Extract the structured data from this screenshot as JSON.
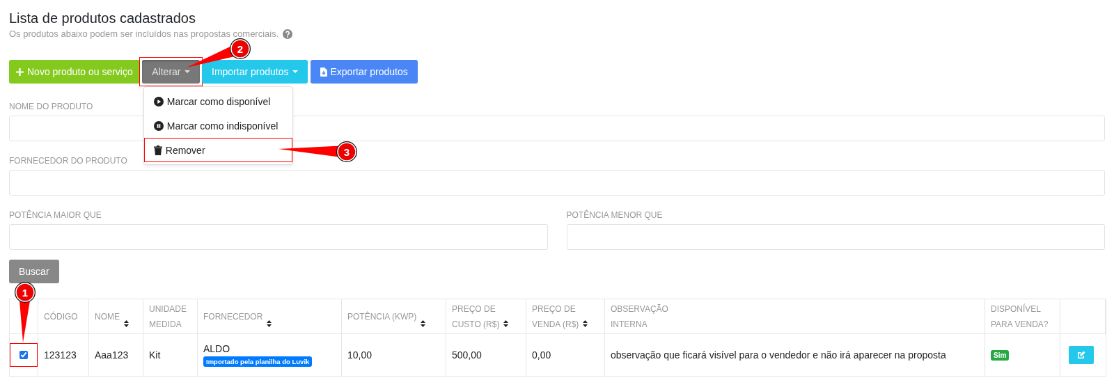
{
  "page": {
    "title": "Lista de produtos cadastrados",
    "subtitle": "Os produtos abaixo podem ser incluídos nas propostas comerciais."
  },
  "toolbar": {
    "buttons": [
      {
        "label": "Novo produto ou serviço",
        "kind": "add"
      },
      {
        "label": "Alterar",
        "kind": "dropdown",
        "expanded": true,
        "highlighted": true
      },
      {
        "label": "Importar produtos",
        "kind": "dropdown",
        "expanded": false
      },
      {
        "label": "Exportar produtos",
        "kind": "export"
      }
    ]
  },
  "dropdown_menu": {
    "items": [
      {
        "label": "Marcar como disponível"
      },
      {
        "label": "Marcar como indisponível"
      },
      {
        "label": "Remover",
        "highlighted": true
      }
    ]
  },
  "filters": [
    [
      {
        "label": "NOME DO PRODUTO"
      }
    ],
    [
      {
        "label": "FORNECEDOR DO PRODUTO"
      }
    ],
    [
      {
        "label": "POTÊNCIA MAIOR QUE"
      },
      {
        "label": "POTÊNCIA MENOR QUE"
      }
    ]
  ],
  "search_button": "Buscar",
  "table": {
    "columns": [
      {
        "label": "CÓDIGO"
      },
      {
        "label": "NOME",
        "sortable": true
      },
      {
        "label": "UNIDADE\nMEDIDA"
      },
      {
        "label": "FORNECEDOR",
        "sortable": true
      },
      {
        "label": "POTÊNCIA (KWP)",
        "sortable": true
      },
      {
        "label": "PREÇO DE\nCUSTO (R$)",
        "sortable": true
      },
      {
        "label": "PREÇO DE\nVENDA (R$)",
        "sortable": true
      },
      {
        "label": "OBSERVAÇÃO\nINTERNA"
      },
      {
        "label": "DISPONÍVEL\nPARA VENDA?"
      }
    ],
    "rows": [
      {
        "selected": true,
        "highlighted": true,
        "code": "123123",
        "name": "Aaa123",
        "unit": "Kit",
        "supplier": "ALDO",
        "supplier_tag": "Importado pela planilha do Luvik",
        "power": "10,00",
        "cost_price": "500,00",
        "sale_price": "0,00",
        "internal_note": "observação que ficará visível para o vendedor e não irá aparecer na proposta",
        "available": true,
        "available_label": "Sim"
      }
    ]
  },
  "callouts": [
    {
      "number": "1"
    },
    {
      "number": "2"
    },
    {
      "number": "3"
    }
  ]
}
